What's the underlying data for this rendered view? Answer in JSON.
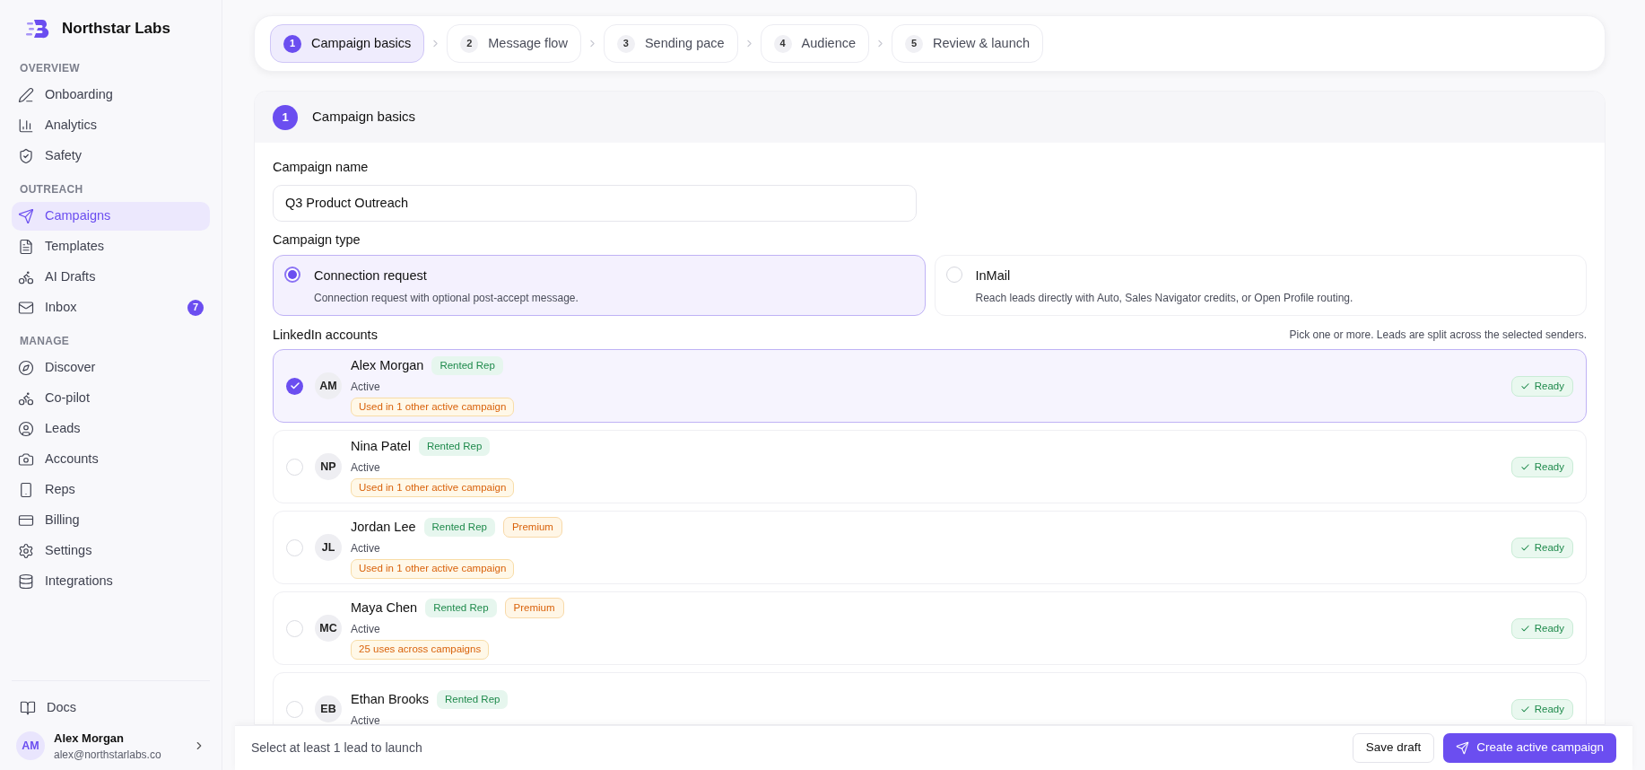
{
  "brand": {
    "name": "Northstar Labs"
  },
  "sidebar": {
    "sections": [
      {
        "title": "OVERVIEW",
        "items": [
          {
            "label": "Onboarding",
            "selected": false
          },
          {
            "label": "Analytics",
            "selected": false
          },
          {
            "label": "Safety",
            "selected": false
          }
        ]
      },
      {
        "title": "OUTREACH",
        "items": [
          {
            "label": "Campaigns",
            "selected": true
          },
          {
            "label": "Templates",
            "selected": false
          },
          {
            "label": "AI Drafts",
            "selected": false
          },
          {
            "label": "Inbox",
            "selected": false,
            "badge": "7"
          }
        ]
      },
      {
        "title": "MANAGE",
        "items": [
          {
            "label": "Discover",
            "selected": false
          },
          {
            "label": "Co-pilot",
            "selected": false
          },
          {
            "label": "Leads",
            "selected": false
          },
          {
            "label": "Accounts",
            "selected": false
          },
          {
            "label": "Reps",
            "selected": false
          },
          {
            "label": "Billing",
            "selected": false
          },
          {
            "label": "Settings",
            "selected": false
          },
          {
            "label": "Integrations",
            "selected": false
          }
        ]
      }
    ],
    "docs": "Docs",
    "user": {
      "initials": "AM",
      "name": "Alex Morgan",
      "email": "alex@northstarlabs.co"
    }
  },
  "steps": [
    {
      "number": "1",
      "label": "Campaign basics",
      "selected": true
    },
    {
      "number": "2",
      "label": "Message flow",
      "selected": false
    },
    {
      "number": "3",
      "label": "Sending pace",
      "selected": false
    },
    {
      "number": "4",
      "label": "Audience",
      "selected": false
    },
    {
      "number": "5",
      "label": "Review & launch",
      "selected": false
    }
  ],
  "section": {
    "number": "1",
    "title": "Campaign basics"
  },
  "campaign_name": {
    "label": "Campaign name",
    "value": "Q3 Product Outreach"
  },
  "campaign_type": {
    "label": "Campaign type",
    "options": [
      {
        "title": "Connection request",
        "description": "Connection request with optional post-accept message.",
        "selected": true
      },
      {
        "title": "InMail",
        "description": "Reach leads directly with Auto, Sales Navigator credits, or Open Profile routing.",
        "selected": false
      }
    ]
  },
  "accounts": {
    "label": "LinkedIn accounts",
    "hint": "Pick one or more. Leads are split across the selected senders.",
    "rows": [
      {
        "initials": "AM",
        "name": "Alex Morgan",
        "status": "Active",
        "tags": [
          {
            "label": "Rented Rep",
            "kind": "rep"
          }
        ],
        "usage": "Used in 1 other active campaign",
        "ready": "Ready",
        "selected": true
      },
      {
        "initials": "NP",
        "name": "Nina Patel",
        "status": "Active",
        "tags": [
          {
            "label": "Rented Rep",
            "kind": "rep"
          }
        ],
        "usage": "Used in 1 other active campaign",
        "ready": "Ready",
        "selected": false
      },
      {
        "initials": "JL",
        "name": "Jordan Lee",
        "status": "Active",
        "tags": [
          {
            "label": "Rented Rep",
            "kind": "rep"
          },
          {
            "label": "Premium",
            "kind": "premium"
          }
        ],
        "usage": "Used in 1 other active campaign",
        "ready": "Ready",
        "selected": false
      },
      {
        "initials": "MC",
        "name": "Maya Chen",
        "status": "Active",
        "tags": [
          {
            "label": "Rented Rep",
            "kind": "rep"
          },
          {
            "label": "Premium",
            "kind": "premium"
          }
        ],
        "usage": "25 uses across campaigns",
        "ready": "Ready",
        "selected": false
      },
      {
        "initials": "EB",
        "name": "Ethan Brooks",
        "status": "Active",
        "tags": [
          {
            "label": "Rented Rep",
            "kind": "rep"
          }
        ],
        "ready": "Ready",
        "selected": false
      }
    ]
  },
  "footer": {
    "message": "Select at least 1 lead to launch",
    "save": "Save draft",
    "create": "Create active campaign"
  }
}
